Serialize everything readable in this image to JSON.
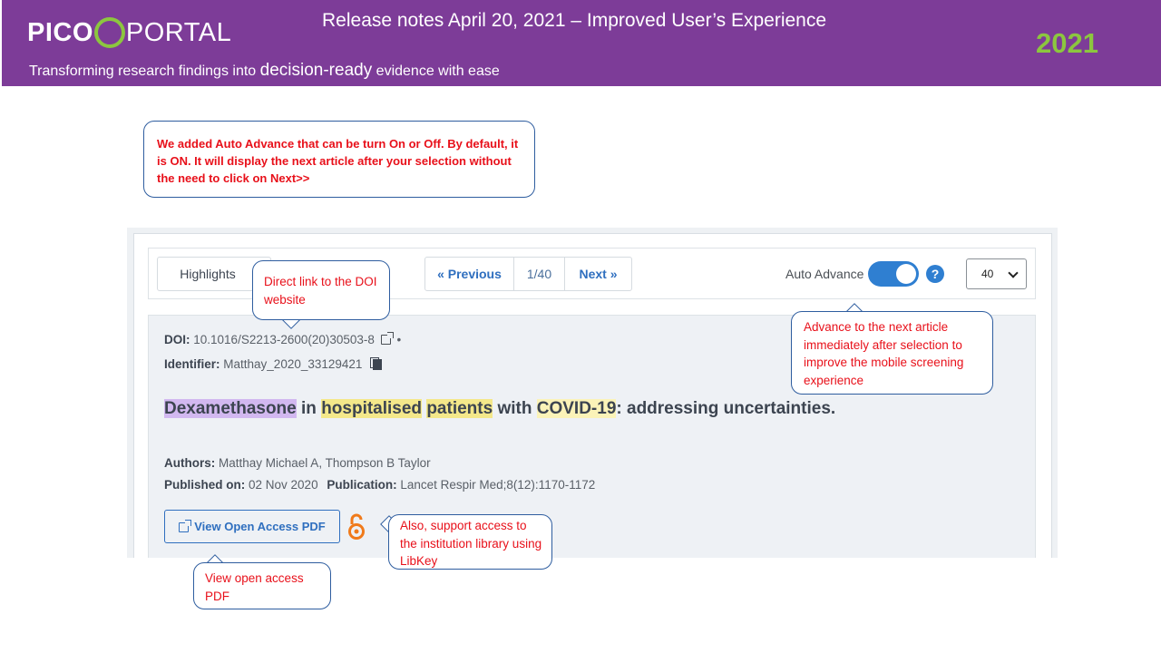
{
  "header": {
    "logo_left": "PICO",
    "logo_right": "PORTAL",
    "tagline_start": "Transforming research findings into ",
    "tagline_big": "decision-ready",
    "tagline_end": " evidence with ease",
    "release_title": "Release notes April 20, 2021 – Improved User’s Experience",
    "year": "2021"
  },
  "callouts": {
    "auto_advance_intro": "We added Auto Advance that can be turn On or Off.  By default, it is ON.  It will display the next article after your selection without the need to click on Next>>",
    "doi_link": "Direct link to the DOI website",
    "advance_next": "Advance to the next article immediately after selection to improve the mobile screening experience",
    "libkey": "Also, support  access to the institution library using LibKey",
    "open_pdf": "View open access PDF"
  },
  "toolbar": {
    "highlights_label": "Highlights",
    "previous_label": "«  Previous",
    "page_count": "1/40",
    "next_label": "Next  »",
    "auto_advance_label": "Auto Advance",
    "auto_advance_on": true,
    "help_icon": "?",
    "per_page_value": "40"
  },
  "article": {
    "doi_label": "DOI:",
    "doi_value": "10.1016/S2213-2600(20)30503-8",
    "doi_separator": "•",
    "identifier_label": "Identifier:",
    "identifier_value": "Matthay_2020_33129421",
    "title_parts": {
      "p1": "Dexamethasone",
      "p2": " in ",
      "p3": "hospitalised",
      "p4": " ",
      "p5": "patients",
      "p6": " with ",
      "p7": "COVID-19",
      "p8": ": addressing uncertainties."
    },
    "authors_label": "Authors:",
    "authors_value": "Matthay Michael A, Thompson B Taylor",
    "published_label": "Published on:",
    "published_value": "02 Nov 2020",
    "publication_label": "Publication:",
    "publication_value": "Lancet Respir Med;8(12):1170-1172",
    "pdf_button_label": "View Open Access PDF"
  },
  "colors": {
    "banner": "#7d3c98",
    "accent_green": "#8cc63f",
    "link_blue": "#2f6fbf",
    "callout_text": "#e8101a",
    "highlight_purple": "#d2b8f0",
    "highlight_yellow": "#f4e88a",
    "open_access_orange": "#f07a1a"
  },
  "icons": {
    "external_link": "external-link-icon",
    "copy": "copy-icon",
    "help": "question-circle-icon",
    "open_access": "open-access-lock-icon",
    "dropdown": "chevron-down-icon"
  }
}
